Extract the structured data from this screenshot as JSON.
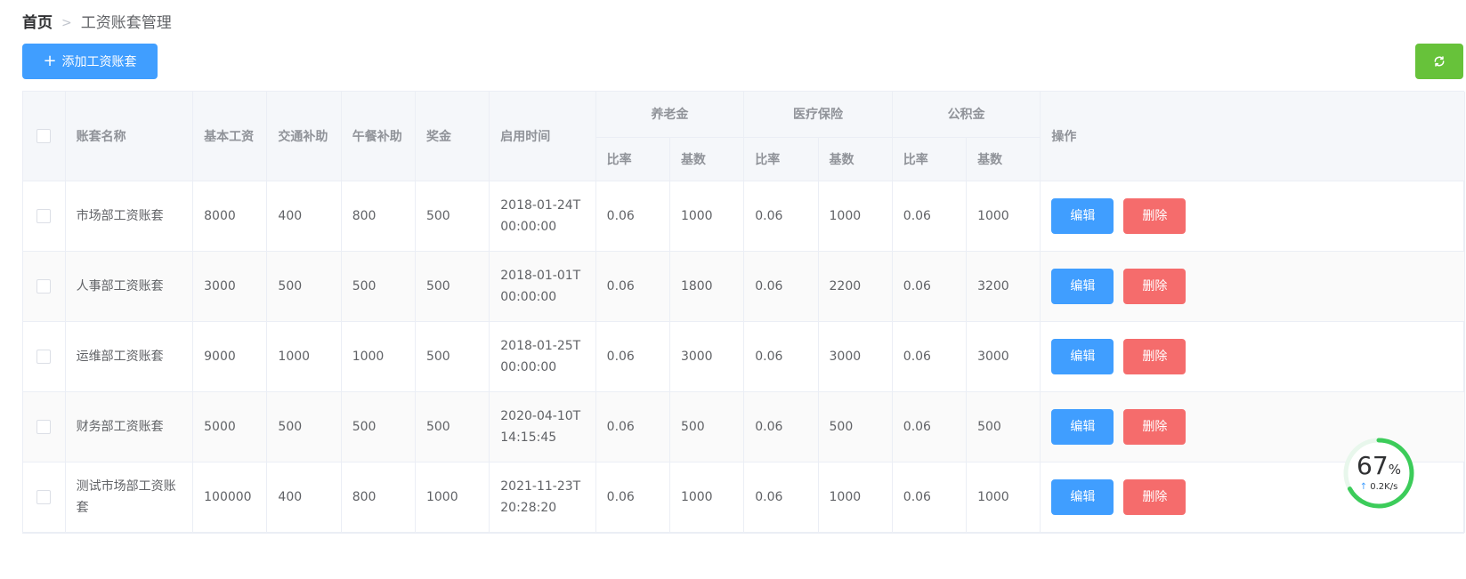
{
  "breadcrumb": {
    "home": "首页",
    "separator": ">",
    "current": "工资账套管理"
  },
  "toolbar": {
    "add_label": "添加工资账套",
    "add_icon": "plus-icon",
    "refresh_icon": "refresh-icon"
  },
  "colors": {
    "primary": "#409eff",
    "success": "#67c23a",
    "danger": "#f56c6c",
    "widget_ring": "#3ccc5a"
  },
  "table": {
    "headers": {
      "name": "账套名称",
      "basic": "基本工资",
      "traffic": "交通补助",
      "lunch": "午餐补助",
      "bonus": "奖金",
      "start": "启用时间",
      "pension": "养老金",
      "medical": "医疗保险",
      "fund": "公积金",
      "rate": "比率",
      "base": "基数",
      "actions": "操作"
    },
    "rows": [
      {
        "name": "市场部工资账套",
        "basic": "8000",
        "traffic": "400",
        "lunch": "800",
        "bonus": "500",
        "start": "2018-01-24T00:00:00",
        "pension_rate": "0.06",
        "pension_base": "1000",
        "medical_rate": "0.06",
        "medical_base": "1000",
        "fund_rate": "0.06",
        "fund_base": "1000",
        "edit": "编辑",
        "delete": "删除"
      },
      {
        "name": "人事部工资账套",
        "basic": "3000",
        "traffic": "500",
        "lunch": "500",
        "bonus": "500",
        "start": "2018-01-01T00:00:00",
        "pension_rate": "0.06",
        "pension_base": "1800",
        "medical_rate": "0.06",
        "medical_base": "2200",
        "fund_rate": "0.06",
        "fund_base": "3200",
        "edit": "编辑",
        "delete": "删除"
      },
      {
        "name": "运维部工资账套",
        "basic": "9000",
        "traffic": "1000",
        "lunch": "1000",
        "bonus": "500",
        "start": "2018-01-25T00:00:00",
        "pension_rate": "0.06",
        "pension_base": "3000",
        "medical_rate": "0.06",
        "medical_base": "3000",
        "fund_rate": "0.06",
        "fund_base": "3000",
        "edit": "编辑",
        "delete": "删除"
      },
      {
        "name": "财务部工资账套",
        "basic": "5000",
        "traffic": "500",
        "lunch": "500",
        "bonus": "500",
        "start": "2020-04-10T14:15:45",
        "pension_rate": "0.06",
        "pension_base": "500",
        "medical_rate": "0.06",
        "medical_base": "500",
        "fund_rate": "0.06",
        "fund_base": "500",
        "edit": "编辑",
        "delete": "删除"
      },
      {
        "name": "测试市场部工资账套",
        "basic": "100000",
        "traffic": "400",
        "lunch": "800",
        "bonus": "1000",
        "start": "2021-11-23T20:28:20",
        "pension_rate": "0.06",
        "pension_base": "1000",
        "medical_rate": "0.06",
        "medical_base": "1000",
        "fund_rate": "0.06",
        "fund_base": "1000",
        "edit": "编辑",
        "delete": "删除"
      }
    ]
  },
  "net_widget": {
    "percent": "67",
    "percent_symbol": "%",
    "speed": "0.2K/s",
    "arrow": "↑",
    "percent_value": 0.67
  }
}
